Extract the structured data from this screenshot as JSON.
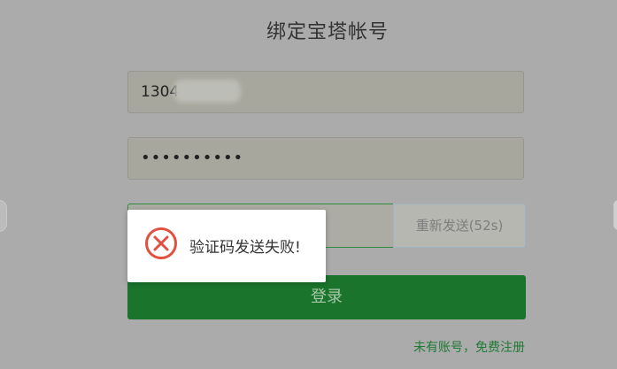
{
  "page": {
    "title": "绑定宝塔帐号"
  },
  "form": {
    "phone_value": "1304",
    "password_value": "••••••••••",
    "code_value": "",
    "resend_label": "重新发送(52s)",
    "login_label": "登录",
    "register_link": "未有账号，免费注册"
  },
  "toast": {
    "message": "验证码发送失败!",
    "icon": "error-circle-x-icon",
    "icon_color": "#e2503f"
  },
  "colors": {
    "primary_green": "#1a742b",
    "overlay_gray": "#ababab"
  }
}
